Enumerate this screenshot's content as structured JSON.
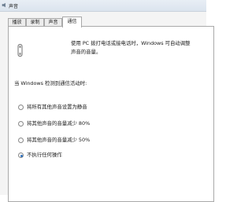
{
  "window": {
    "title": "声音"
  },
  "tabs": [
    {
      "label": "播放",
      "active": false
    },
    {
      "label": "录制",
      "active": false
    },
    {
      "label": "声音",
      "active": false
    },
    {
      "label": "通信",
      "active": true
    }
  ],
  "communications": {
    "icon": "telephone-icon",
    "description_line1": "使用 PC 拨打电话或接电话时，Windows 可自动调整",
    "description_line2": "声音的音量。",
    "heading": "当 Windows 检测到通信活动时:",
    "options": [
      {
        "label": "将所有其他声音设置为静音",
        "checked": false
      },
      {
        "label": "将其他声音的音量减少 80%",
        "checked": false
      },
      {
        "label": "将其他声音的音量减少 50%",
        "checked": false
      },
      {
        "label": "不执行任何操作",
        "checked": true
      }
    ]
  },
  "colors": {
    "accent": "#2c6fbd",
    "border": "#a9a9a9"
  }
}
